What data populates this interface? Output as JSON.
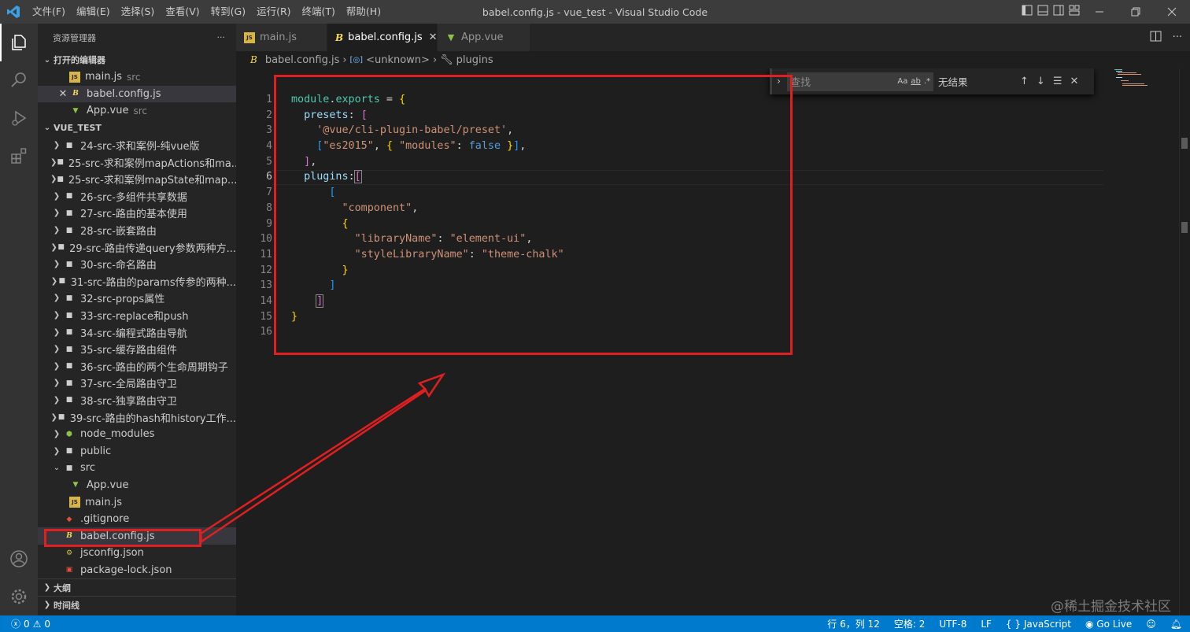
{
  "titlebar": {
    "menu": [
      "文件(F)",
      "编辑(E)",
      "选择(S)",
      "查看(V)",
      "转到(G)",
      "运行(R)",
      "终端(T)",
      "帮助(H)"
    ],
    "window_title": "babel.config.js - vue_test - Visual Studio Code"
  },
  "sidebar": {
    "title": "资源管理器",
    "more": "···",
    "open_editors": {
      "label": "打开的编辑器",
      "items": [
        {
          "name": "main.js",
          "desc": "src",
          "icon": "js"
        },
        {
          "name": "babel.config.js",
          "desc": "",
          "icon": "babel"
        },
        {
          "name": "App.vue",
          "desc": "src",
          "icon": "vue"
        }
      ]
    },
    "project": {
      "label": "VUE_TEST",
      "folders": [
        "24-src-求和案例-纯vue版",
        "25-src-求和案例mapActions和ma...",
        "25-src-求和案例mapState和map...",
        "26-src-多组件共享数据",
        "27-src-路由的基本使用",
        "28-src-嵌套路由",
        "29-src-路由传递query参数两种方...",
        "30-src-命名路由",
        "31-src-路由的params传参的两种...",
        "32-src-props属性",
        "33-src-replace和push",
        "34-src-编程式路由导航",
        "35-src-缓存路由组件",
        "36-src-路由的两个生命周期钩子",
        "37-src-全局路由守卫",
        "38-src-独享路由守卫",
        "39-src-路由的hash和history工作..."
      ],
      "node_modules": "node_modules",
      "public": "public",
      "src": "src",
      "src_files": [
        "App.vue",
        "main.js"
      ],
      "root_files": [
        ".gitignore",
        "babel.config.js",
        "jsconfig.json",
        "package-lock.json"
      ]
    },
    "outline": "大纲",
    "timeline": "时间线"
  },
  "tabs": [
    {
      "name": "main.js",
      "icon": "js",
      "active": false
    },
    {
      "name": "babel.config.js",
      "icon": "babel",
      "active": true
    },
    {
      "name": "App.vue",
      "icon": "vue",
      "active": false
    }
  ],
  "breadcrumb": [
    "babel.config.js",
    "<unknown>",
    "plugins"
  ],
  "find": {
    "placeholder": "查找",
    "opt_case": "Aa",
    "opt_word": "ab",
    "opt_regex": ".*",
    "result": "无结果"
  },
  "line_numbers": [
    "1",
    "2",
    "3",
    "4",
    "5",
    "6",
    "7",
    "8",
    "9",
    "10",
    "11",
    "12",
    "13",
    "14",
    "15",
    "16"
  ],
  "code": {
    "l1_a": "module",
    "l1_b": ".",
    "l1_c": "exports",
    "l1_d": " = ",
    "l1_e": "{",
    "l2_a": "presets",
    "l2_b": ": ",
    "l2_c": "[",
    "l3": "'@vue/cli-plugin-babel/preset'",
    "l3_comma": ",",
    "l4_a": "[",
    "l4_b": "\"es2015\"",
    "l4_c": ", ",
    "l4_d": "{",
    "l4_e": " ",
    "l4_f": "\"modules\"",
    "l4_g": ": ",
    "l4_h": "false",
    "l4_i": " ",
    "l4_j": "}",
    "l4_k": "]",
    "l4_l": ",",
    "l5_a": "]",
    "l5_b": ",",
    "l6_a": "plugins",
    "l6_b": ":",
    "l6_c": "[",
    "l7": "[",
    "l8_a": "\"component\"",
    "l8_b": ",",
    "l9": "{",
    "l10_a": "\"libraryName\"",
    "l10_b": ": ",
    "l10_c": "\"element-ui\"",
    "l10_d": ",",
    "l11_a": "\"styleLibraryName\"",
    "l11_b": ": ",
    "l11_c": "\"theme-chalk\"",
    "l12": "}",
    "l13": "]",
    "l14": "]",
    "l15": "}"
  },
  "statusbar": {
    "errors": "0",
    "warnings": "0",
    "position": "行 6，列 12",
    "spaces": "空格: 2",
    "encoding": "UTF-8",
    "eol": "LF",
    "language": "{ } JavaScript",
    "golive": "Go Live"
  },
  "watermark": "@稀土掘金技术社区",
  "colors": {
    "accent": "#007acc",
    "annotation_red": "#e02020"
  }
}
